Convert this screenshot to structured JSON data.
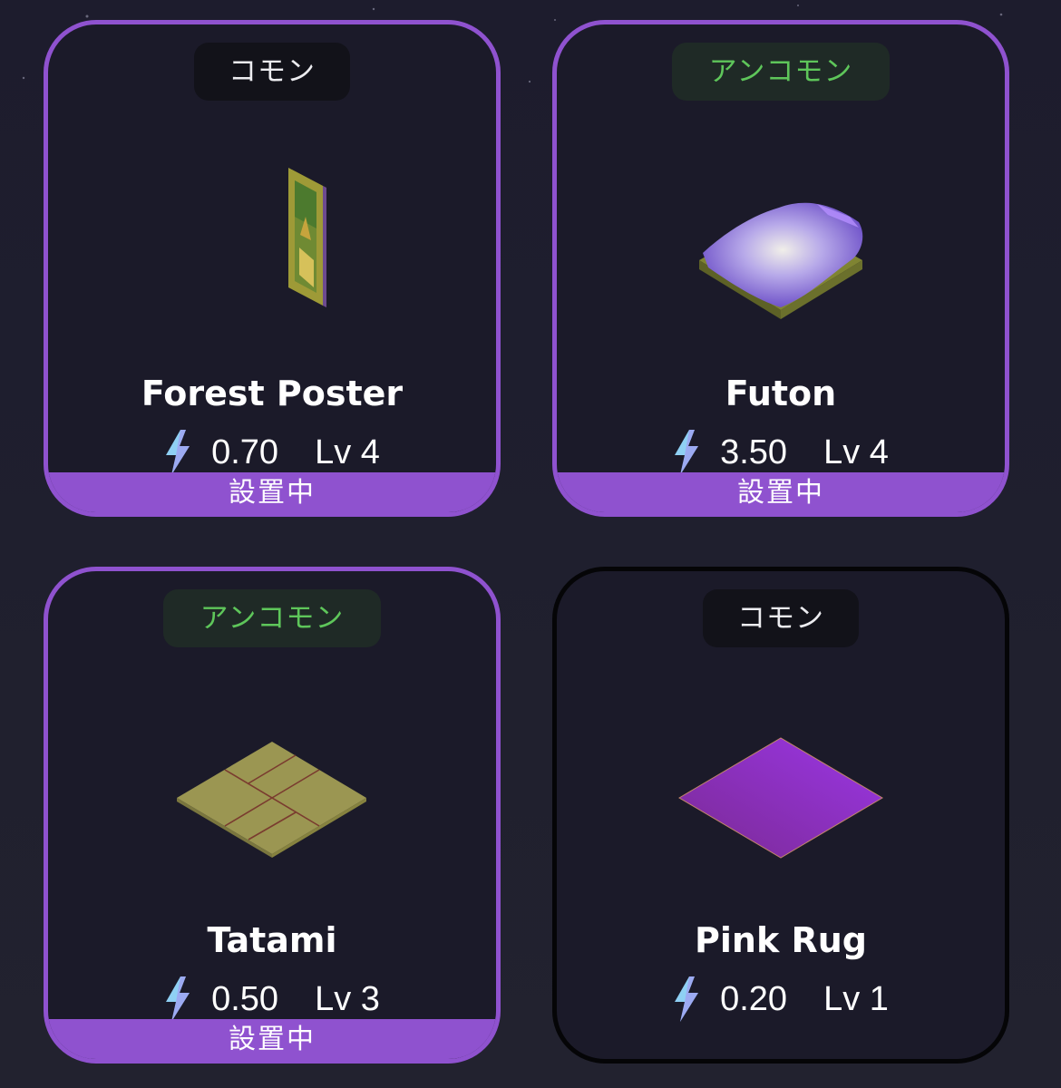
{
  "items": [
    {
      "name": "Forest Poster",
      "rarity": "コモン",
      "energy": "0.70",
      "level": "Lv 4",
      "status": "設置中"
    },
    {
      "name": "Futon",
      "rarity": "アンコモン",
      "energy": "3.50",
      "level": "Lv 4",
      "status": "設置中"
    },
    {
      "name": "Tatami",
      "rarity": "アンコモン",
      "energy": "0.50",
      "level": "Lv 3",
      "status": "設置中"
    },
    {
      "name": "Pink Rug",
      "rarity": "コモン",
      "energy": "0.20",
      "level": "Lv 1"
    }
  ],
  "icons": {
    "energy": "lightning-bolt-icon"
  },
  "colors": {
    "placed_accent": "#8f52cf",
    "uncommon_text": "#5ec65a",
    "common_text": "#ececf0",
    "bolt": "#8fd0f4"
  }
}
